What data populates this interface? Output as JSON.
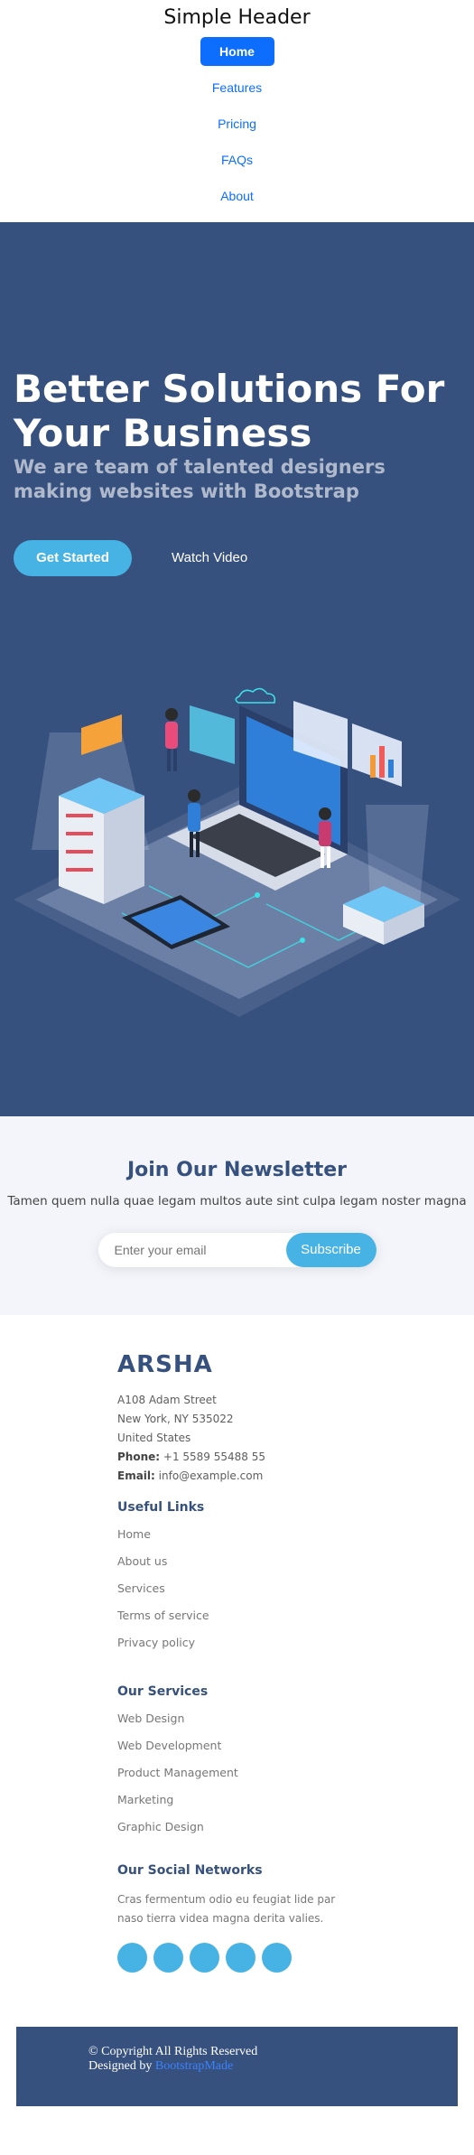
{
  "header": {
    "title": "Simple Header",
    "nav": [
      "Home",
      "Features",
      "Pricing",
      "FAQs",
      "About"
    ]
  },
  "hero": {
    "title": "Better Solutions For Your Business",
    "subtitle": "We are team of talented designers making websites with Bootstrap",
    "get_started": "Get Started",
    "watch_video": "Watch Video",
    "image": "hero-illustration"
  },
  "newsletter": {
    "title": "Join Our Newsletter",
    "text": "Tamen quem nulla quae legam multos aute sint culpa legam noster magna",
    "email_placeholder": "Enter your email",
    "subscribe": "Subscribe"
  },
  "footer": {
    "brand": "ARSHA",
    "address": [
      "A108 Adam Street",
      "New York, NY 535022",
      "United States"
    ],
    "phone_label": "Phone:",
    "phone": "+1 5589 55488 55",
    "email_label": "Email:",
    "email": "info@example.com",
    "useful_links_title": "Useful Links",
    "useful_links": [
      "Home",
      "About us",
      "Services",
      "Terms of service",
      "Privacy policy"
    ],
    "services_title": "Our Services",
    "services": [
      "Web Design",
      "Web Development",
      "Product Management",
      "Marketing",
      "Graphic Design"
    ],
    "social_title": "Our Social Networks",
    "social_text": "Cras fermentum odio eu feugiat lide par naso tierra videa magna derita valies.",
    "social_icons": [
      "twitter-icon",
      "facebook-icon",
      "instagram-icon",
      "skype-icon",
      "linkedin-icon"
    ],
    "copyright": "© Copyright All Rights Reserved",
    "designed_by": "Designed by",
    "designer": "BootstrapMade"
  },
  "colors": {
    "primary_blue": "#0d6efd",
    "hero_bg": "#37517e",
    "accent": "#47b2e4",
    "newsletter_bg": "#f3f5fa"
  }
}
